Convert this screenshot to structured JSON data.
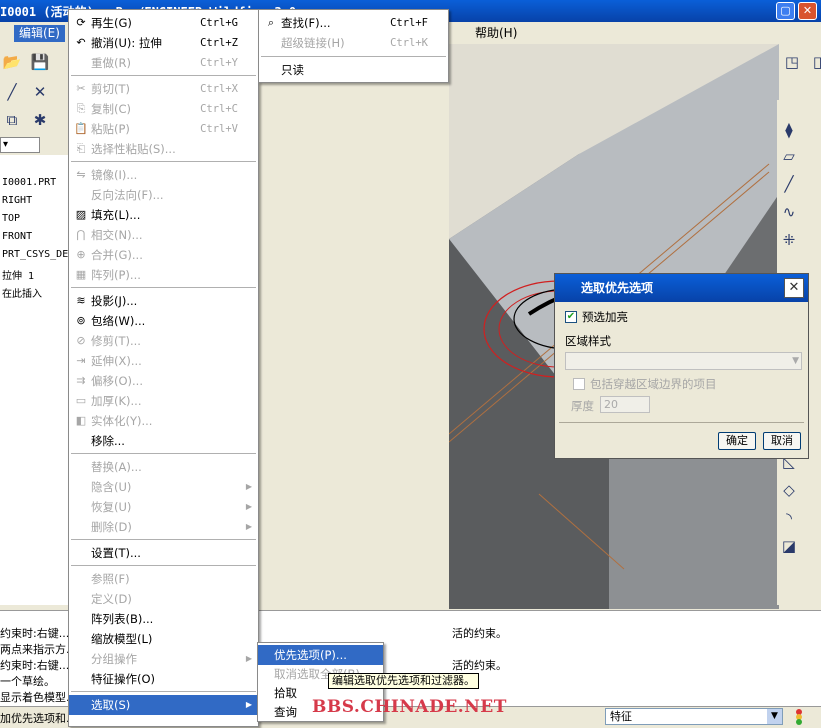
{
  "window": {
    "title": "I0001 (活动的) - Pro/ENGINEER Wildfire 3.0"
  },
  "menubar": {
    "edit": "编辑(E)",
    "help": "帮助(H)"
  },
  "model_tree": {
    "filter": "",
    "items": [
      "I0001.PRT",
      "RIGHT",
      "TOP",
      "FRONT",
      "PRT_CSYS_DE",
      "拉伸 1",
      "在此插入"
    ]
  },
  "edit_menu": {
    "items": [
      {
        "label": "再生(G)",
        "shortcut": "Ctrl+G",
        "icon": "regenerate-icon",
        "enabled": true
      },
      {
        "label": "撤消(U): 拉伸",
        "shortcut": "Ctrl+Z",
        "icon": "undo-icon",
        "enabled": true
      },
      {
        "label": "重做(R)",
        "shortcut": "Ctrl+Y",
        "icon": "",
        "enabled": false
      },
      {
        "label": "剪切(T)",
        "shortcut": "Ctrl+X",
        "icon": "cut-icon",
        "enabled": false
      },
      {
        "label": "复制(C)",
        "shortcut": "Ctrl+C",
        "icon": "copy-icon",
        "enabled": false
      },
      {
        "label": "粘贴(P)",
        "shortcut": "Ctrl+V",
        "icon": "paste-icon",
        "enabled": false
      },
      {
        "label": "选择性粘贴(S)...",
        "shortcut": "",
        "icon": "paste-special-icon",
        "enabled": false
      },
      {
        "label": "镜像(I)...",
        "shortcut": "",
        "icon": "mirror-icon",
        "enabled": false
      },
      {
        "label": "反向法向(F)...",
        "shortcut": "",
        "icon": "",
        "enabled": false
      },
      {
        "label": "填充(L)...",
        "shortcut": "",
        "icon": "fill-icon",
        "enabled": true
      },
      {
        "label": "相交(N)...",
        "shortcut": "",
        "icon": "intersect-icon",
        "enabled": false
      },
      {
        "label": "合并(G)...",
        "shortcut": "",
        "icon": "merge-icon",
        "enabled": false
      },
      {
        "label": "阵列(P)...",
        "shortcut": "",
        "icon": "pattern-icon",
        "enabled": false
      },
      {
        "label": "投影(J)...",
        "shortcut": "",
        "icon": "project-icon",
        "enabled": true
      },
      {
        "label": "包络(W)...",
        "shortcut": "",
        "icon": "wrap-icon",
        "enabled": true
      },
      {
        "label": "修剪(T)...",
        "shortcut": "",
        "icon": "trim-icon",
        "enabled": false
      },
      {
        "label": "延伸(X)...",
        "shortcut": "",
        "icon": "extend-icon",
        "enabled": false
      },
      {
        "label": "偏移(O)...",
        "shortcut": "",
        "icon": "offset-icon",
        "enabled": false
      },
      {
        "label": "加厚(K)...",
        "shortcut": "",
        "icon": "thicken-icon",
        "enabled": false
      },
      {
        "label": "实体化(Y)...",
        "shortcut": "",
        "icon": "solidify-icon",
        "enabled": false
      },
      {
        "label": "移除...",
        "shortcut": "",
        "icon": "",
        "enabled": true
      },
      {
        "label": "替换(A)...",
        "shortcut": "",
        "icon": "",
        "enabled": false
      },
      {
        "label": "隐含(U)",
        "shortcut": "",
        "icon": "",
        "enabled": false,
        "submenu": true
      },
      {
        "label": "恢复(U)",
        "shortcut": "",
        "icon": "",
        "enabled": false,
        "submenu": true
      },
      {
        "label": "删除(D)",
        "shortcut": "",
        "icon": "",
        "enabled": false,
        "submenu": true
      },
      {
        "label": "设置(T)...",
        "shortcut": "",
        "icon": "",
        "enabled": true
      },
      {
        "label": "参照(F)",
        "shortcut": "",
        "icon": "",
        "enabled": false
      },
      {
        "label": "定义(D)",
        "shortcut": "",
        "icon": "",
        "enabled": false
      },
      {
        "label": "阵列表(B)...",
        "shortcut": "",
        "icon": "",
        "enabled": true
      },
      {
        "label": "缩放模型(L)",
        "shortcut": "",
        "icon": "",
        "enabled": true
      },
      {
        "label": "分组操作",
        "shortcut": "",
        "icon": "",
        "enabled": false,
        "submenu": true
      },
      {
        "label": "特征操作(O)",
        "shortcut": "",
        "icon": "",
        "enabled": true
      },
      {
        "label": "选取(S)",
        "shortcut": "",
        "icon": "",
        "enabled": true,
        "submenu": true,
        "highlighted": true
      }
    ]
  },
  "find_menu": {
    "items": [
      {
        "label": "查找(F)...",
        "shortcut": "Ctrl+F",
        "enabled": true
      },
      {
        "label": "超级链接(H)",
        "shortcut": "Ctrl+K",
        "enabled": false
      },
      {
        "label": "只读",
        "shortcut": "",
        "enabled": true
      }
    ]
  },
  "select_submenu": {
    "items": [
      {
        "label": "优先选项(P)...",
        "enabled": true,
        "highlighted": true
      },
      {
        "label": "取消选取全部(B)",
        "enabled": false
      },
      {
        "label": "拾取",
        "enabled": true
      },
      {
        "label": "查询",
        "enabled": true
      }
    ]
  },
  "tooltip": "编辑选取优先选项和过滤器。",
  "dialog": {
    "title": "选取优先选项",
    "preselect_highlight": "预选加亮",
    "preselect_checked": true,
    "region_style_label": "区域样式",
    "region_style_value": "",
    "include_items": "包括穿越区域边界的项目",
    "thickness_label": "厚度",
    "thickness_value": "20",
    "ok": "确定",
    "cancel": "取消"
  },
  "messages": [
    "约束时:右键...",
    "两点来指示方...",
    "约束时:右键...",
    "一个草绘。",
    "显示着色模型...",
    "加优先选项和..."
  ],
  "messages_right": [
    "活的约束。",
    "活的约束。"
  ],
  "statusbar": {
    "filter": "特征"
  },
  "watermark": "BBS.CHINADE.NET",
  "colors": {
    "menu_highlight": "#316ac5",
    "titlebar": "#0a5fd8",
    "viewport_bg": "#e0ddd2"
  }
}
